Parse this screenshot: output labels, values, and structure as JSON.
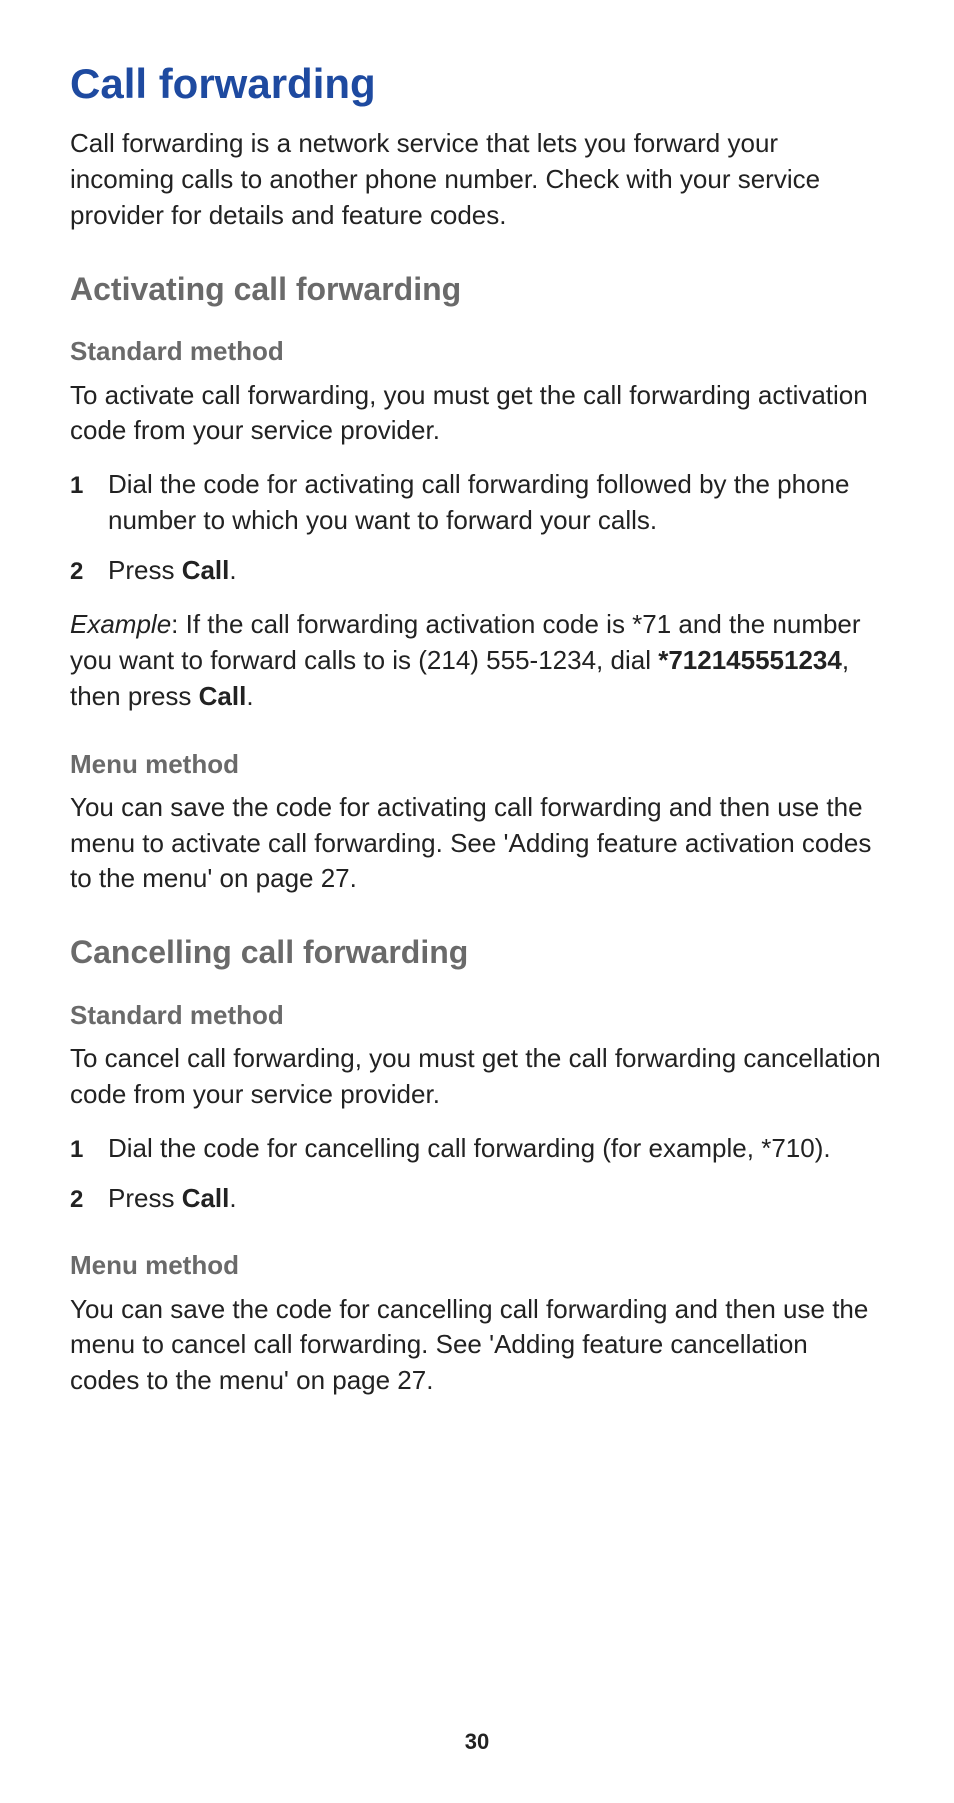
{
  "title": "Call forwarding",
  "intro": "Call forwarding is a network service that lets you forward your incoming calls to another phone number. Check with your service provider for details and feature codes.",
  "section_activating": {
    "heading": "Activating call forwarding",
    "standard": {
      "heading": "Standard method",
      "body": "To activate call forwarding, you must get the call forwarding activation code from your service provider.",
      "step1_num": "1",
      "step1": "Dial the code for activating call forwarding followed by the phone number to which you want to forward your calls.",
      "step2_num": "2",
      "step2_prefix": "Press ",
      "step2_bold": "Call",
      "step2_suffix": ".",
      "example_label": "Example",
      "example_before": ":  If the call forwarding activation code is *71 and the number you want to forward calls to is (214) 555-1234, dial ",
      "example_code": "*712145551234",
      "example_mid": ", then press ",
      "example_call": "Call",
      "example_after": "."
    },
    "menu": {
      "heading": "Menu method",
      "body": "You can save the code for activating call forwarding and then use the menu to activate call forwarding. See 'Adding feature activation codes to the menu' on page 27."
    }
  },
  "section_cancelling": {
    "heading": "Cancelling call forwarding",
    "standard": {
      "heading": "Standard method",
      "body": "To cancel call forwarding, you must get the call forwarding cancellation code from your service provider.",
      "step1_num": "1",
      "step1": "Dial the code for cancelling call forwarding (for example, *710).",
      "step2_num": "2",
      "step2_prefix": "Press ",
      "step2_bold": "Call",
      "step2_suffix": "."
    },
    "menu": {
      "heading": "Menu method",
      "body": "You can save the code for cancelling call forwarding and then use the menu to cancel call forwarding. See 'Adding feature cancellation codes to the menu' on page 27."
    }
  },
  "page_number": "30"
}
